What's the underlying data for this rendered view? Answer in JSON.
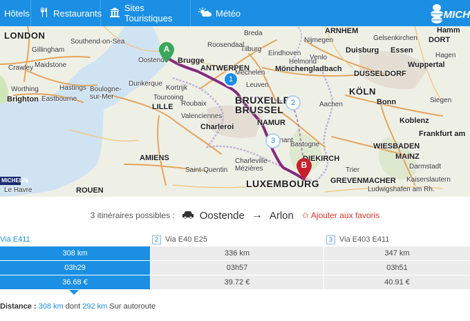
{
  "nav": {
    "hotels": "Hôtels",
    "restaurants": "Restaurants",
    "sites": "Sites Touristiques",
    "meteo": "Météo",
    "brand": "MICH"
  },
  "map": {
    "cities": [
      {
        "id": "london",
        "label": "LONDON",
        "cls": "lg"
      },
      {
        "id": "southend",
        "label": "Southend-on-Sea",
        "cls": "sm"
      },
      {
        "id": "gillingham",
        "label": "Gillingham",
        "cls": "sm"
      },
      {
        "id": "crawley",
        "label": "Crawley",
        "cls": "sm"
      },
      {
        "id": "maidstone",
        "label": "Maidstone",
        "cls": "sm"
      },
      {
        "id": "worthing",
        "label": "Worthing",
        "cls": "sm"
      },
      {
        "id": "brighton",
        "label": "Brighton",
        "cls": ""
      },
      {
        "id": "eastbourne",
        "label": "Eastbourne",
        "cls": "sm"
      },
      {
        "id": "hastings",
        "label": "Hastings",
        "cls": "sm"
      },
      {
        "id": "boulogne",
        "label": "Boulogne-sur-Mer",
        "cls": "sm"
      },
      {
        "id": "lille",
        "label": "LILLE",
        "cls": ""
      },
      {
        "id": "amiens",
        "label": "AMIENS",
        "cls": ""
      },
      {
        "id": "rouen",
        "label": "ROUEN",
        "cls": ""
      },
      {
        "id": "lehavre",
        "label": "Le Havre",
        "cls": "sm"
      },
      {
        "id": "ostende",
        "label": "Oostende",
        "cls": "sm"
      },
      {
        "id": "brugge",
        "label": "Brugge",
        "cls": ""
      },
      {
        "id": "dunkerque",
        "label": "Dunkerque",
        "cls": "sm"
      },
      {
        "id": "kortrijk",
        "label": "Kortrijk",
        "cls": "sm"
      },
      {
        "id": "tourcoing",
        "label": "Tourcoing",
        "cls": "sm"
      },
      {
        "id": "roubaix",
        "label": "Roubaix",
        "cls": "sm"
      },
      {
        "id": "valenciennes",
        "label": "Valenciennes",
        "cls": "sm"
      },
      {
        "id": "charleroi",
        "label": "Charleroi",
        "cls": ""
      },
      {
        "id": "saintquentin",
        "label": "Saint-Quentin",
        "cls": "sm"
      },
      {
        "id": "charleville",
        "label": "Charleville-Mézières",
        "cls": "sm"
      },
      {
        "id": "bruxelles",
        "label": "BRUXELLES",
        "cls": "xl"
      },
      {
        "id": "brussel",
        "label": "BRUSSEL",
        "cls": "xl"
      },
      {
        "id": "namur",
        "label": "NAMUR",
        "cls": ""
      },
      {
        "id": "leuven",
        "label": "Leuven",
        "cls": "sm"
      },
      {
        "id": "mechelen",
        "label": "Mechelen",
        "cls": "sm"
      },
      {
        "id": "antwerpen",
        "label": "ANTWERPEN",
        "cls": ""
      },
      {
        "id": "breda",
        "label": "Breda",
        "cls": "sm"
      },
      {
        "id": "tilburg",
        "label": "Tilburg",
        "cls": "sm"
      },
      {
        "id": "eindhoven",
        "label": "Eindhoven",
        "cls": "sm"
      },
      {
        "id": "venlo",
        "label": "Venlo",
        "cls": "sm"
      },
      {
        "id": "moenchengladbach",
        "label": "Mönchengladbach",
        "cls": ""
      },
      {
        "id": "duesseldorf",
        "label": "DUSSELDORF",
        "cls": ""
      },
      {
        "id": "duisburg",
        "label": "Duisburg",
        "cls": ""
      },
      {
        "id": "essen",
        "label": "Essen",
        "cls": ""
      },
      {
        "id": "gelsenkirchen",
        "label": "Gelsenkirchen",
        "cls": "sm"
      },
      {
        "id": "hamm",
        "label": "Hamm",
        "cls": ""
      },
      {
        "id": "dortmund",
        "label": "DORT",
        "cls": ""
      },
      {
        "id": "wuppertal",
        "label": "Wuppertal",
        "cls": ""
      },
      {
        "id": "hagen",
        "label": "Hagen",
        "cls": "sm"
      },
      {
        "id": "koeln",
        "label": "KÖLN",
        "cls": "lg"
      },
      {
        "id": "bonn",
        "label": "Bonn",
        "cls": ""
      },
      {
        "id": "aachen",
        "label": "Aachen",
        "cls": "sm"
      },
      {
        "id": "siegen",
        "label": "Siegen",
        "cls": "sm"
      },
      {
        "id": "koblenz",
        "label": "Koblenz",
        "cls": ""
      },
      {
        "id": "frankfurt",
        "label": "Frankfurt am",
        "cls": ""
      },
      {
        "id": "wiesbaden",
        "label": "WIESBADEN",
        "cls": ""
      },
      {
        "id": "mainz",
        "label": "MAINZ",
        "cls": ""
      },
      {
        "id": "darmstadt",
        "label": "Darmstadt",
        "cls": "sm"
      },
      {
        "id": "trier",
        "label": "Trier",
        "cls": "sm"
      },
      {
        "id": "luxembourg",
        "label": "LUXEMBOURG",
        "cls": "xl"
      },
      {
        "id": "grevenmacher",
        "label": "GREVENMACHER",
        "cls": ""
      },
      {
        "id": "kaiserslautern",
        "label": "Kaiserslautern",
        "cls": "sm"
      },
      {
        "id": "ludwigshafen",
        "label": "Ludwigshafen am Rh.",
        "cls": "sm"
      },
      {
        "id": "diekirch",
        "label": "DIEKIRCH",
        "cls": ""
      },
      {
        "id": "bastogne",
        "label": "Bastogne",
        "cls": "sm"
      },
      {
        "id": "roosendaal",
        "label": "Roosendaal",
        "cls": "sm"
      },
      {
        "id": "arnhem",
        "label": "ARNHEM",
        "cls": ""
      },
      {
        "id": "nijmegen",
        "label": "Nijmegen",
        "cls": "sm"
      },
      {
        "id": "helmond",
        "label": "Helmond",
        "cls": "sm"
      },
      {
        "id": "dinant",
        "label": "Dinant",
        "cls": "sm"
      }
    ],
    "marker_a": "A",
    "marker_b": "B",
    "steps": [
      "1",
      "2",
      "3"
    ],
    "badge": "MICHELIN"
  },
  "summary": {
    "count_text": "3 itinéraires possibles :",
    "from": "Oostende",
    "arrow": "→",
    "to": "Arlon",
    "favorite": "Ajouter aux favoris"
  },
  "routes": [
    {
      "num": "1",
      "via": "Via E411",
      "distance": "308 km",
      "time": "03h29",
      "cost": "36.68 €"
    },
    {
      "num": "2",
      "via": "Via E40 E25",
      "distance": "336 km",
      "time": "03h57",
      "cost": "39.72 €"
    },
    {
      "num": "3",
      "via": "Via E403 E411",
      "distance": "347 km",
      "time": "03h51",
      "cost": "40.91 €"
    }
  ],
  "detail": {
    "label": "Distance :",
    "total": "308 km",
    "mid": "dont",
    "motorway": "292 km",
    "tail": "Sur autoroute"
  },
  "colors": {
    "accent": "#1a8fe3",
    "route": "#8a1a7a",
    "marker_a": "#3aa65a",
    "marker_b": "#c8202a",
    "favorite": "#e0322a"
  }
}
